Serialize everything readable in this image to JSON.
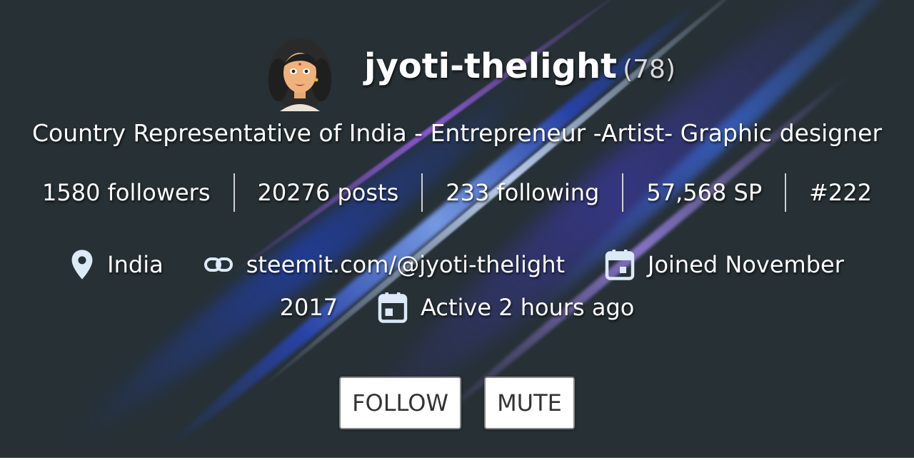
{
  "profile": {
    "username": "jyoti-thelight",
    "reputation": "(78)",
    "about": "Country Representative of India - Entrepreneur -Artist- Graphic designer"
  },
  "stats": {
    "followers": "1580 followers",
    "posts": "20276 posts",
    "following": "233 following",
    "sp": "57,568 SP",
    "rank": "#222"
  },
  "meta": {
    "location": "India",
    "website": "steemit.com/@jyoti-thelight",
    "joined_part1": "Joined November",
    "joined_part2": "2017",
    "active": "Active 2 hours ago",
    "icons": [
      "location-pin-icon",
      "link-icon",
      "calendar-icon"
    ]
  },
  "buttons": {
    "follow": "FOLLOW",
    "mute": "MUTE"
  },
  "colors": {
    "background": "#263035",
    "icon": "#dce9f7",
    "button_bg": "#ffffff",
    "button_text": "#333333"
  }
}
